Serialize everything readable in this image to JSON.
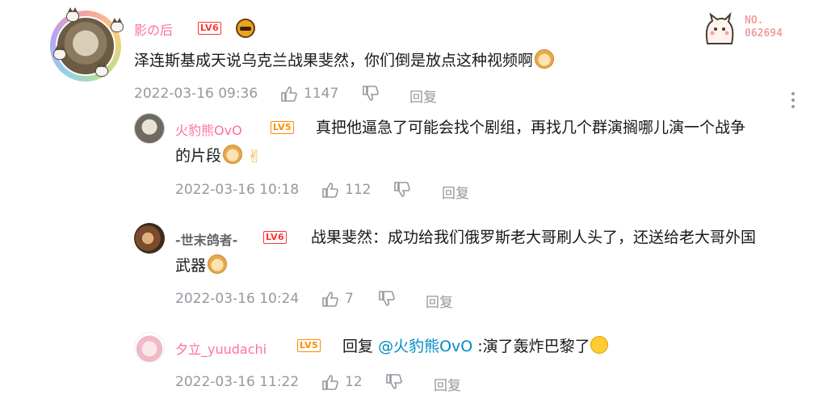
{
  "comments": [
    {
      "username": "影の后",
      "level": "LV6",
      "text": "泽连斯基成天说乌克兰战果斐然，你们倒是放点这种视频啊",
      "time": "2022-03-16 09:36",
      "likes": "1147",
      "reply_label": "回复",
      "badge": {
        "line1": "NO.",
        "line2": "062694"
      }
    },
    {
      "username": "火豹熊OvO",
      "level": "LV5",
      "text_line1": "真把他逼急了可能会找个剧组，再找几个群演搁哪儿演一个战争",
      "text_line2": "的片段",
      "time": "2022-03-16 10:18",
      "likes": "112",
      "reply_label": "回复"
    },
    {
      "username": "-世末鸽者-",
      "level": "LV6",
      "text_line1": "战果斐然：成功给我们俄罗斯老大哥刷人头了，还送给老大哥外国",
      "text_line2": "武器",
      "time": "2022-03-16 10:24",
      "likes": "7",
      "reply_label": "回复"
    },
    {
      "username": "夕立_yuudachi",
      "level": "LV5",
      "reply_prefix": "回复",
      "mention": "@火豹熊OvO",
      "text": ":演了轰炸巴黎了",
      "time": "2022-03-16 11:22",
      "likes": "12",
      "reply_label": "回复"
    }
  ],
  "colors": {
    "username": "#fb7299",
    "meta": "#9499a0",
    "link": "#008ac5"
  }
}
